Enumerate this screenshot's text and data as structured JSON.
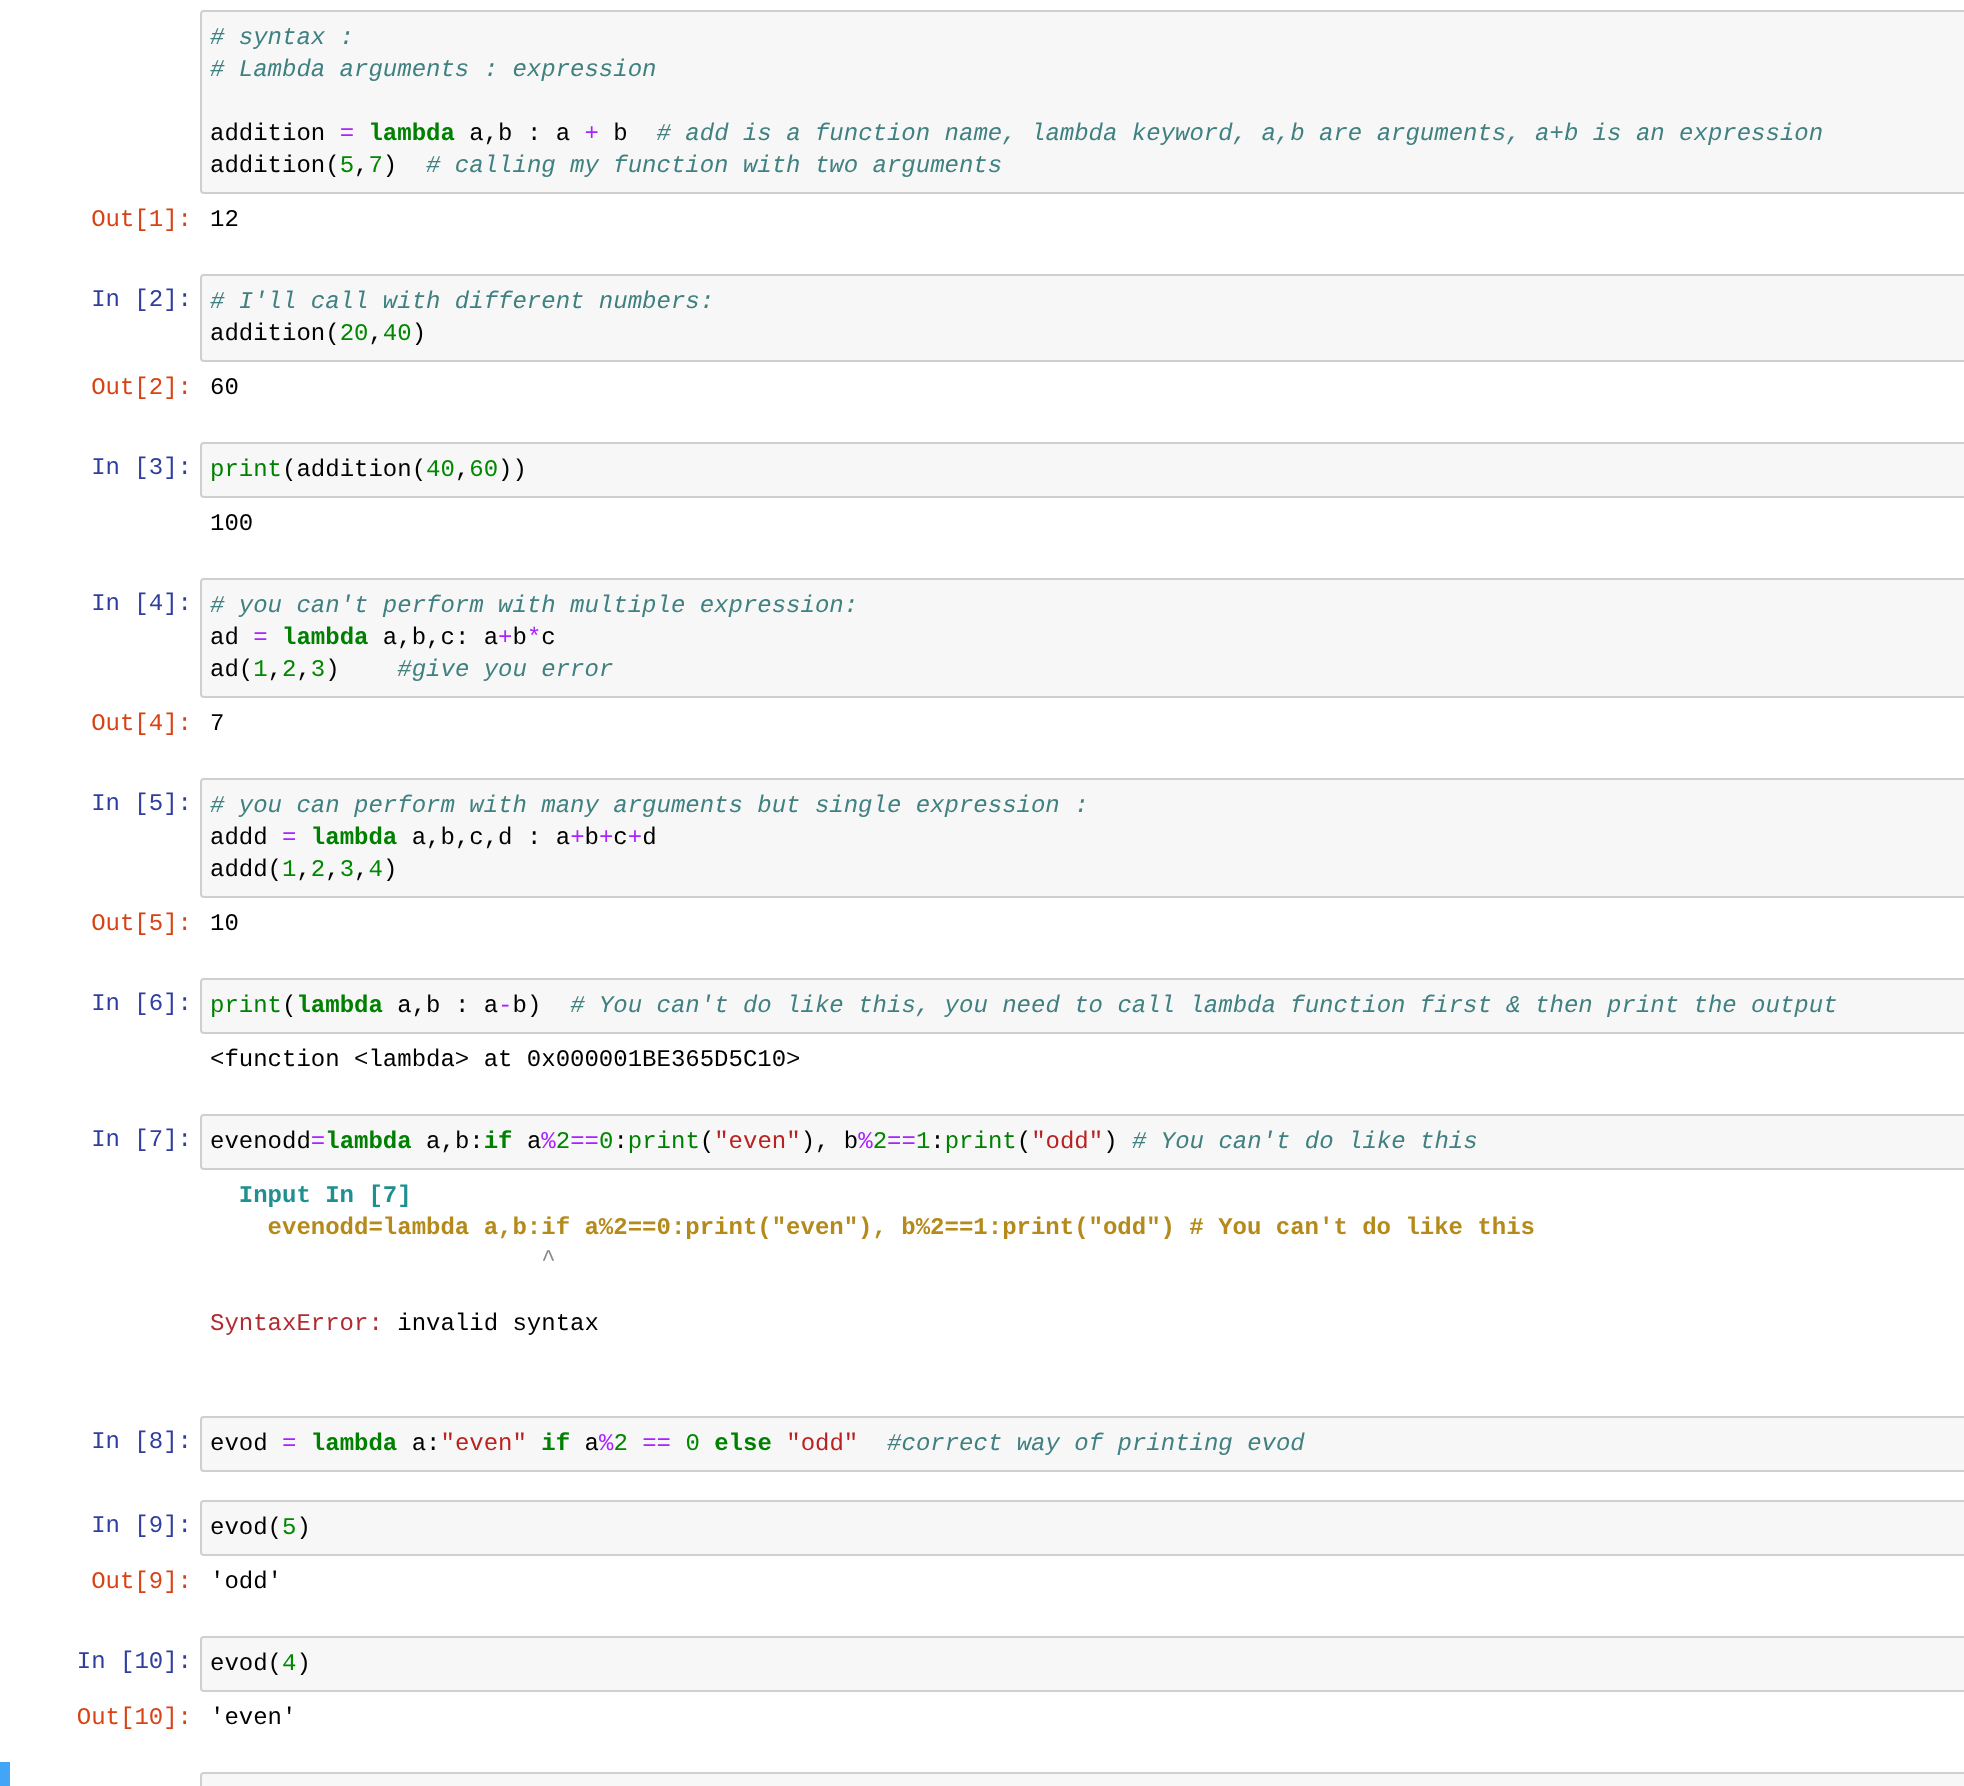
{
  "cells": [
    {
      "selected": false,
      "input": [
        {
          "kind": "code",
          "tokens": [
            {
              "kind": "c",
              "text": "# syntax :"
            }
          ]
        },
        {
          "kind": "code",
          "tokens": [
            {
              "kind": "c",
              "text": "# Lambda arguments : expression"
            }
          ]
        },
        {
          "kind": "blank"
        },
        {
          "kind": "code",
          "tokens": [
            {
              "kind": "t",
              "text": "addition "
            },
            {
              "kind": "o",
              "text": "="
            },
            {
              "kind": "k",
              "text": " lambda"
            },
            {
              "kind": "t",
              "text": " a,b : a "
            },
            {
              "kind": "o",
              "text": "+"
            },
            {
              "kind": "t",
              "text": " b  "
            },
            {
              "kind": "c",
              "text": "# add is a function name, lambda keyword, a,b are arguments, a+b is an expression"
            }
          ]
        },
        {
          "kind": "code",
          "tokens": [
            {
              "kind": "t",
              "text": "addition("
            },
            {
              "kind": "n",
              "text": "5"
            },
            {
              "kind": "t",
              "text": ","
            },
            {
              "kind": "n",
              "text": "7"
            },
            {
              "kind": "t",
              "text": ")  "
            },
            {
              "kind": "c",
              "text": "# calling my function with two arguments"
            }
          ]
        }
      ],
      "outputs": [
        {
          "kind": "result",
          "prompt": "Out[1]:",
          "lines": [
            [
              {
                "kind": "t",
                "text": "12"
              }
            ]
          ]
        }
      ]
    },
    {
      "selected": false,
      "prompt": "In [2]:",
      "input": [
        {
          "kind": "code",
          "tokens": [
            {
              "kind": "c",
              "text": "# I'll call with different numbers:"
            }
          ]
        },
        {
          "kind": "code",
          "tokens": [
            {
              "kind": "t",
              "text": "addition("
            },
            {
              "kind": "n",
              "text": "20"
            },
            {
              "kind": "t",
              "text": ","
            },
            {
              "kind": "n",
              "text": "40"
            },
            {
              "kind": "t",
              "text": ")"
            }
          ]
        }
      ],
      "outputs": [
        {
          "kind": "result",
          "prompt": "Out[2]:",
          "lines": [
            [
              {
                "kind": "t",
                "text": "60"
              }
            ]
          ]
        }
      ]
    },
    {
      "selected": false,
      "prompt": "In [3]:",
      "input": [
        {
          "kind": "code",
          "tokens": [
            {
              "kind": "b",
              "text": "print"
            },
            {
              "kind": "t",
              "text": "(addition("
            },
            {
              "kind": "n",
              "text": "40"
            },
            {
              "kind": "t",
              "text": ","
            },
            {
              "kind": "n",
              "text": "60"
            },
            {
              "kind": "t",
              "text": "))"
            }
          ]
        }
      ],
      "outputs": [
        {
          "kind": "stream",
          "lines": [
            [
              {
                "kind": "t",
                "text": "100"
              }
            ]
          ]
        }
      ]
    },
    {
      "selected": false,
      "prompt": "In [4]:",
      "input": [
        {
          "kind": "code",
          "tokens": [
            {
              "kind": "c",
              "text": "# you can't perform with multiple expression:"
            }
          ]
        },
        {
          "kind": "code",
          "tokens": [
            {
              "kind": "t",
              "text": "ad "
            },
            {
              "kind": "o",
              "text": "="
            },
            {
              "kind": "k",
              "text": " lambda"
            },
            {
              "kind": "t",
              "text": " a,b,c: a"
            },
            {
              "kind": "o",
              "text": "+"
            },
            {
              "kind": "t",
              "text": "b"
            },
            {
              "kind": "o",
              "text": "*"
            },
            {
              "kind": "t",
              "text": "c"
            }
          ]
        },
        {
          "kind": "code",
          "tokens": [
            {
              "kind": "t",
              "text": "ad("
            },
            {
              "kind": "n",
              "text": "1"
            },
            {
              "kind": "t",
              "text": ","
            },
            {
              "kind": "n",
              "text": "2"
            },
            {
              "kind": "t",
              "text": ","
            },
            {
              "kind": "n",
              "text": "3"
            },
            {
              "kind": "t",
              "text": ")    "
            },
            {
              "kind": "c",
              "text": "#give you error"
            }
          ]
        }
      ],
      "outputs": [
        {
          "kind": "result",
          "prompt": "Out[4]:",
          "lines": [
            [
              {
                "kind": "t",
                "text": "7"
              }
            ]
          ]
        }
      ]
    },
    {
      "selected": false,
      "prompt": "In [5]:",
      "input": [
        {
          "kind": "code",
          "tokens": [
            {
              "kind": "c",
              "text": "# you can perform with many arguments but single expression :"
            }
          ]
        },
        {
          "kind": "code",
          "tokens": [
            {
              "kind": "t",
              "text": "addd "
            },
            {
              "kind": "o",
              "text": "="
            },
            {
              "kind": "k",
              "text": " lambda"
            },
            {
              "kind": "t",
              "text": " a,b,c,d : a"
            },
            {
              "kind": "o",
              "text": "+"
            },
            {
              "kind": "t",
              "text": "b"
            },
            {
              "kind": "o",
              "text": "+"
            },
            {
              "kind": "t",
              "text": "c"
            },
            {
              "kind": "o",
              "text": "+"
            },
            {
              "kind": "t",
              "text": "d"
            }
          ]
        },
        {
          "kind": "code",
          "tokens": [
            {
              "kind": "t",
              "text": "addd("
            },
            {
              "kind": "n",
              "text": "1"
            },
            {
              "kind": "t",
              "text": ","
            },
            {
              "kind": "n",
              "text": "2"
            },
            {
              "kind": "t",
              "text": ","
            },
            {
              "kind": "n",
              "text": "3"
            },
            {
              "kind": "t",
              "text": ","
            },
            {
              "kind": "n",
              "text": "4"
            },
            {
              "kind": "t",
              "text": ")"
            }
          ]
        }
      ],
      "outputs": [
        {
          "kind": "result",
          "prompt": "Out[5]:",
          "lines": [
            [
              {
                "kind": "t",
                "text": "10"
              }
            ]
          ]
        }
      ]
    },
    {
      "selected": false,
      "prompt": "In [6]:",
      "input": [
        {
          "kind": "code",
          "tokens": [
            {
              "kind": "b",
              "text": "print"
            },
            {
              "kind": "t",
              "text": "("
            },
            {
              "kind": "k",
              "text": "lambda"
            },
            {
              "kind": "t",
              "text": " a,b : a"
            },
            {
              "kind": "o",
              "text": "-"
            },
            {
              "kind": "t",
              "text": "b)  "
            },
            {
              "kind": "c",
              "text": "# You can't do like this, you need to call lambda function first & then print the output"
            }
          ]
        }
      ],
      "outputs": [
        {
          "kind": "stream",
          "lines": [
            [
              {
                "kind": "t",
                "text": "<function <lambda> at 0x000001BE365D5C10>"
              }
            ]
          ]
        }
      ]
    },
    {
      "selected": false,
      "prompt": "In [7]:",
      "input": [
        {
          "kind": "code",
          "tokens": [
            {
              "kind": "t",
              "text": "evenodd"
            },
            {
              "kind": "o",
              "text": "="
            },
            {
              "kind": "k",
              "text": "lambda"
            },
            {
              "kind": "t",
              "text": " a,b:"
            },
            {
              "kind": "k",
              "text": "if"
            },
            {
              "kind": "t",
              "text": " a"
            },
            {
              "kind": "o",
              "text": "%"
            },
            {
              "kind": "n",
              "text": "2"
            },
            {
              "kind": "o",
              "text": "=="
            },
            {
              "kind": "n",
              "text": "0"
            },
            {
              "kind": "t",
              "text": ":"
            },
            {
              "kind": "b",
              "text": "print"
            },
            {
              "kind": "t",
              "text": "("
            },
            {
              "kind": "s",
              "text": "\"even\""
            },
            {
              "kind": "t",
              "text": "), b"
            },
            {
              "kind": "o",
              "text": "%"
            },
            {
              "kind": "n",
              "text": "2"
            },
            {
              "kind": "o",
              "text": "=="
            },
            {
              "kind": "n",
              "text": "1"
            },
            {
              "kind": "t",
              "text": ":"
            },
            {
              "kind": "b",
              "text": "print"
            },
            {
              "kind": "t",
              "text": "("
            },
            {
              "kind": "s",
              "text": "\"odd\""
            },
            {
              "kind": "t",
              "text": ") "
            },
            {
              "kind": "c",
              "text": "# You can't do like this"
            }
          ]
        }
      ],
      "outputs": [
        {
          "kind": "error",
          "lines": [
            [
              {
                "kind": "et",
                "text": "  Input In [7]"
              }
            ],
            [
              {
                "kind": "ey",
                "text": "    evenodd=lambda a,b:if a%2==0:print(\"even\"), b%2==1:print(\"odd\") # You can't do like this"
              }
            ],
            [
              {
                "kind": "eg",
                "text": "                       ^"
              }
            ],
            [
              {
                "kind": "er",
                "text": "SyntaxError:"
              },
              {
                "kind": "t",
                "text": " invalid syntax"
              }
            ]
          ]
        }
      ]
    },
    {
      "selected": false,
      "prompt": "In [8]:",
      "input": [
        {
          "kind": "code",
          "tokens": [
            {
              "kind": "t",
              "text": "evod "
            },
            {
              "kind": "o",
              "text": "="
            },
            {
              "kind": "k",
              "text": " lambda"
            },
            {
              "kind": "t",
              "text": " a:"
            },
            {
              "kind": "s",
              "text": "\"even\""
            },
            {
              "kind": "k",
              "text": " if"
            },
            {
              "kind": "t",
              "text": " a"
            },
            {
              "kind": "o",
              "text": "%"
            },
            {
              "kind": "n",
              "text": "2"
            },
            {
              "kind": "o",
              "text": " =="
            },
            {
              "kind": "n",
              "text": " 0"
            },
            {
              "kind": "k",
              "text": " else"
            },
            {
              "kind": "s",
              "text": " \"odd\""
            },
            {
              "kind": "c",
              "text": "  #correct way of printing evod"
            }
          ]
        }
      ]
    },
    {
      "selected": false,
      "prompt": "In [9]:",
      "input": [
        {
          "kind": "code",
          "tokens": [
            {
              "kind": "t",
              "text": "evod("
            },
            {
              "kind": "n",
              "text": "5"
            },
            {
              "kind": "t",
              "text": ")"
            }
          ]
        }
      ],
      "outputs": [
        {
          "kind": "result",
          "prompt": "Out[9]:",
          "lines": [
            [
              {
                "kind": "t",
                "text": "'odd'"
              }
            ]
          ]
        }
      ]
    },
    {
      "selected": false,
      "prompt": "In [10]:",
      "input": [
        {
          "kind": "code",
          "tokens": [
            {
              "kind": "t",
              "text": "evod("
            },
            {
              "kind": "n",
              "text": "4"
            },
            {
              "kind": "t",
              "text": ")"
            }
          ]
        }
      ],
      "outputs": [
        {
          "kind": "result",
          "prompt": "Out[10]:",
          "lines": [
            [
              {
                "kind": "t",
                "text": "'even'"
              }
            ]
          ]
        }
      ]
    },
    {
      "selected": true
    }
  ]
}
